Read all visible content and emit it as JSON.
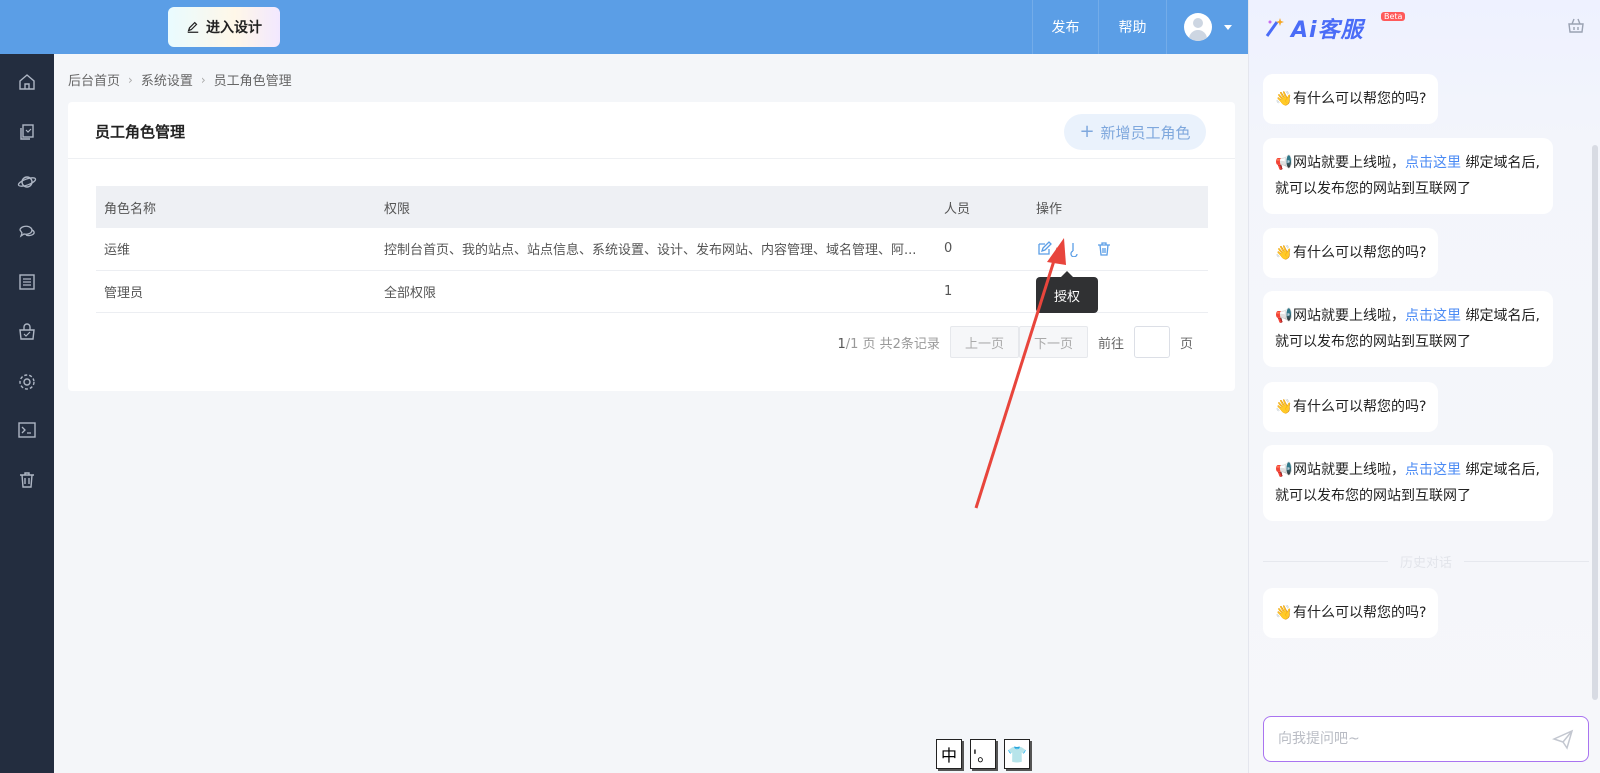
{
  "topbar": {
    "design_label": "进入设计",
    "publish_label": "发布",
    "help_label": "帮助"
  },
  "sidebar": {
    "icons": [
      "home-icon",
      "pages-icon",
      "planet-icon",
      "chat-icon",
      "list-icon",
      "shop-bag-icon",
      "settings-icon",
      "terminal-icon",
      "trash-icon"
    ]
  },
  "breadcrumb": {
    "home": "后台首页",
    "settings": "系统设置",
    "current": "员工角色管理"
  },
  "card": {
    "title": "员工角色管理",
    "add_label": "新增员工角色"
  },
  "table": {
    "headers": {
      "name": "角色名称",
      "permissions": "权限",
      "members": "人员",
      "actions": "操作"
    },
    "rows": [
      {
        "name": "运维",
        "permissions": "控制台首页、我的站点、站点信息、系统设置、设计、发布网站、内容管理、域名管理、阿...",
        "members": "0"
      },
      {
        "name": "管理员",
        "permissions": "全部权限",
        "members": "1"
      }
    ]
  },
  "pager": {
    "page_current": "1",
    "page_rest": "/1 页 共2条记录",
    "prev": "上一页",
    "next": "下一页",
    "goto": "前往",
    "page_unit": "页"
  },
  "tooltip": {
    "text": "授权"
  },
  "ime": {
    "keys": [
      "中",
      "'。",
      "👕"
    ]
  },
  "ai": {
    "brand": "Ai客服",
    "beta": "Beta",
    "messages": [
      {
        "type": "greet",
        "text": "有什么可以帮您的吗?"
      },
      {
        "type": "notice",
        "prefix": "网站就要上线啦，",
        "link": "点击这里",
        "suffix": "绑定域名后,就可以发布您的网站到互联网了"
      },
      {
        "type": "greet",
        "text": "有什么可以帮您的吗?"
      },
      {
        "type": "notice",
        "prefix": "网站就要上线啦，",
        "link": "点击这里",
        "suffix": "绑定域名后,就可以发布您的网站到互联网了"
      },
      {
        "type": "greet",
        "text": "有什么可以帮您的吗?"
      },
      {
        "type": "notice",
        "prefix": "网站就要上线啦，",
        "link": "点击这里",
        "suffix": "绑定域名后,就可以发布您的网站到互联网了"
      },
      {
        "type": "greet",
        "text": "有什么可以帮您的吗?"
      }
    ],
    "history_label": "历史对话",
    "input_placeholder": "向我提问吧~"
  },
  "colors": {
    "topbar": "#5b9ee6",
    "sidebar": "#232d3f",
    "accent": "#4a8af4",
    "ai_brand": "#4a6cf7",
    "arrow": "#e8453c"
  }
}
